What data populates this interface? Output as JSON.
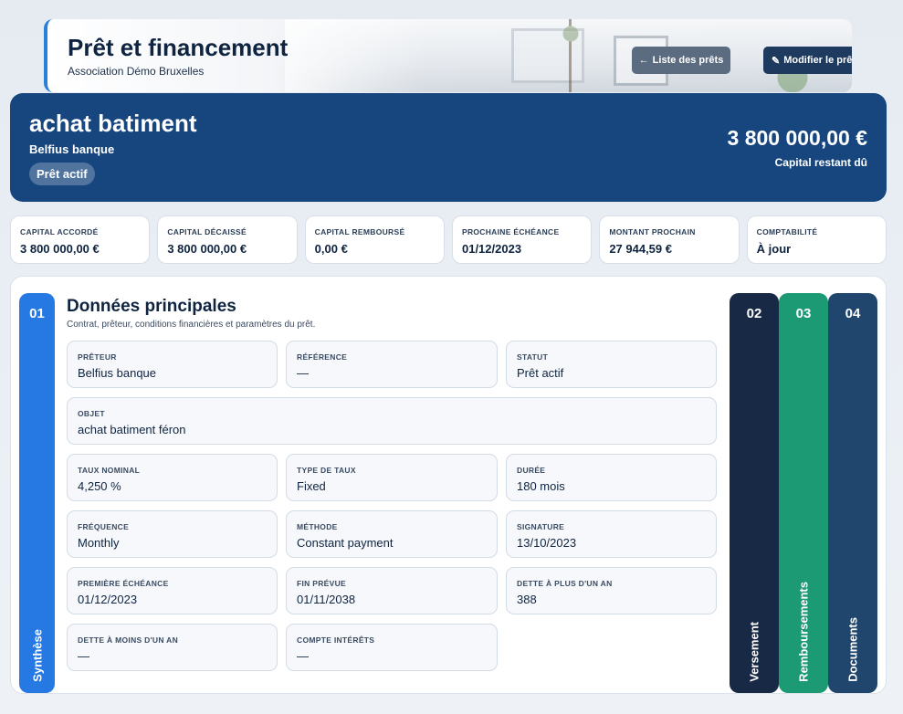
{
  "header": {
    "title": "Prêt et financement",
    "subtitle": "Association Démo Bruxelles",
    "list_button": "Liste des prêts",
    "list_icon": "←",
    "edit_button": "Modifier le prêt",
    "edit_icon": "✎"
  },
  "hero": {
    "title": "achat batiment",
    "lender": "Belfius banque",
    "badge": "Prêt actif",
    "amount": "3 800 000,00 €",
    "amount_label": "Capital restant dû"
  },
  "kpis": [
    {
      "label": "Capital accordé",
      "value": "3 800 000,00 €"
    },
    {
      "label": "Capital décaissé",
      "value": "3 800 000,00 €"
    },
    {
      "label": "Capital remboursé",
      "value": "0,00 €"
    },
    {
      "label": "Prochaine échéance",
      "value": "01/12/2023"
    },
    {
      "label": "Montant prochain",
      "value": "27 944,59 €"
    },
    {
      "label": "Comptabilité",
      "value": "À jour"
    }
  ],
  "tabs": [
    {
      "num": "01",
      "label": "Synthèse"
    },
    {
      "num": "02",
      "label": "Versement"
    },
    {
      "num": "03",
      "label": "Remboursements"
    },
    {
      "num": "04",
      "label": "Documents"
    }
  ],
  "section": {
    "title": "Données principales",
    "subtitle": "Contrat, prêteur, conditions financières et paramètres du prêt."
  },
  "fields": {
    "preteur": {
      "label": "Prêteur",
      "value": "Belfius banque"
    },
    "reference": {
      "label": "Référence",
      "value": "—"
    },
    "statut": {
      "label": "Statut",
      "value": "Prêt actif"
    },
    "objet": {
      "label": "Objet",
      "value": "achat batiment féron"
    },
    "taux_nominal": {
      "label": "Taux nominal",
      "value": "4,250 %"
    },
    "type_taux": {
      "label": "Type de taux",
      "value": "Fixed"
    },
    "duree": {
      "label": "Durée",
      "value": "180 mois"
    },
    "frequence": {
      "label": "Fréquence",
      "value": "Monthly"
    },
    "methode": {
      "label": "Méthode",
      "value": "Constant payment"
    },
    "signature": {
      "label": "Signature",
      "value": "13/10/2023"
    },
    "premiere_echeance": {
      "label": "Première échéance",
      "value": "01/12/2023"
    },
    "fin_prevue": {
      "label": "Fin prévue",
      "value": "01/11/2038"
    },
    "dette_plus_un_an": {
      "label": "Dette à plus d'un an",
      "value": "388"
    },
    "dette_moins_un_an": {
      "label": "Dette à moins d'un an",
      "value": "—"
    },
    "compte_interets": {
      "label": "Compte intérêts",
      "value": "—"
    }
  }
}
